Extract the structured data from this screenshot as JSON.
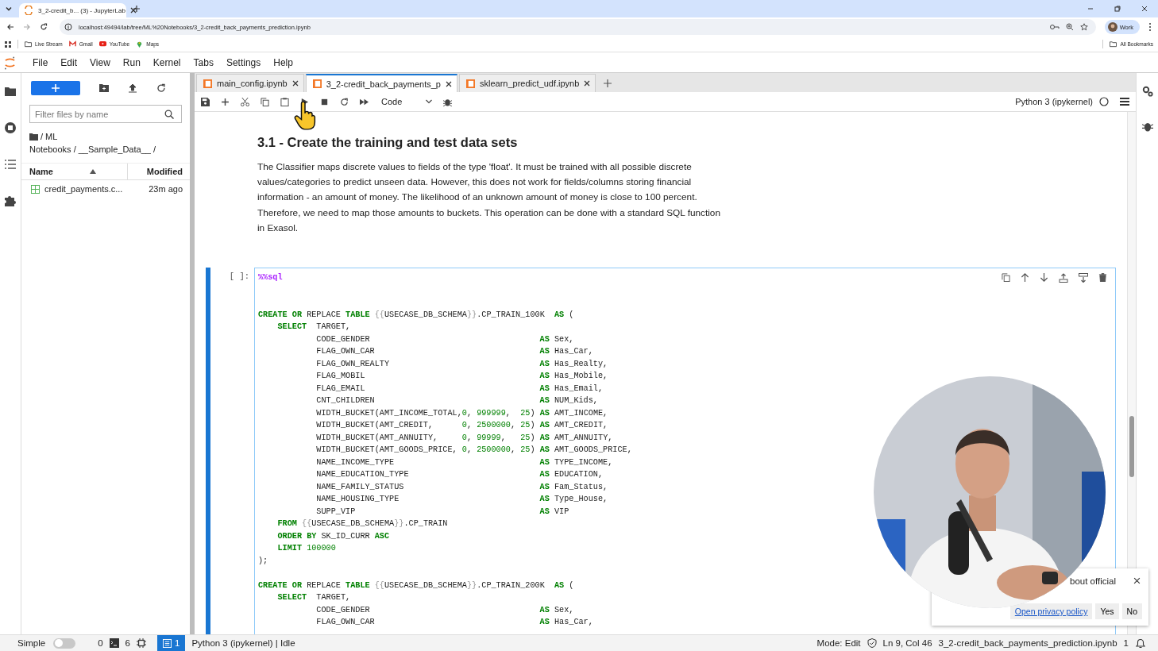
{
  "browser": {
    "tab_title": "3_2-credit_b... (3) - JupyterLab",
    "url": "localhost:49494/lab/tree/ML%20Notebooks/3_2-credit_back_payments_prediction.ipynb",
    "profile": "Work",
    "all_bookmarks": "All Bookmarks",
    "bookmarks": [
      {
        "label": "Live Stream",
        "kind": "folder"
      },
      {
        "label": "Gmail",
        "kind": "gmail"
      },
      {
        "label": "YouTube",
        "kind": "youtube"
      },
      {
        "label": "Maps",
        "kind": "maps"
      }
    ]
  },
  "menu": [
    "File",
    "Edit",
    "View",
    "Run",
    "Kernel",
    "Tabs",
    "Settings",
    "Help"
  ],
  "file_browser": {
    "filter_placeholder": "Filter files by name",
    "breadcrumb": [
      "/ ML",
      "Notebooks / __Sample_Data__ /"
    ],
    "columns": [
      {
        "label": "Name",
        "sorted": true
      },
      {
        "label": "Modified",
        "sorted": false
      }
    ],
    "files": [
      {
        "name": "credit_payments.c...",
        "modified": "23m ago",
        "selected": false
      }
    ]
  },
  "notebook_tabs": [
    {
      "label": "main_config.ipynb",
      "selected": false
    },
    {
      "label": "3_2-credit_back_payments_p",
      "selected": true
    },
    {
      "label": "sklearn_predict_udf.ipynb",
      "selected": false
    }
  ],
  "toolbar": {
    "cell_type": "Code",
    "kernel": "Python 3 (ipykernel)"
  },
  "markdown": {
    "heading": "3.1 - Create the training and test data sets",
    "paragraph": "The Classifier maps discrete values to fields of the type 'float'. It must be trained with all possible discrete values/categories to predict unseen data. However, this does not work for fields/columns storing financial information - an amount of money. The likelihood of an unknown amount of money is close to 100 percent. Therefore, we need to map those amounts to buckets. This operation can be done with a standard SQL function in Exasol."
  },
  "code_cell": {
    "prompt": "[ ]:",
    "active": true,
    "magic": "%%sql",
    "lines": [
      {
        "blank_before": false,
        "tokens": [
          {
            "kind": "kw",
            "text": "CREATE"
          },
          {
            "kind": "kw",
            "text": " OR"
          },
          {
            "kind": "plain",
            "text": " REPLACE "
          },
          {
            "kind": "kw",
            "text": "TABLE"
          },
          {
            "kind": "brace",
            "text": " {{"
          },
          {
            "kind": "plain",
            "text": "USECASE_DB_SCHEMA"
          },
          {
            "kind": "brace",
            "text": "}}"
          },
          {
            "kind": "plain",
            "text": ".CP_TRAIN_100K  "
          },
          {
            "kind": "kw",
            "text": "AS"
          },
          {
            "kind": "plain",
            "text": " ("
          }
        ]
      },
      {
        "blank_before": false,
        "tokens": [
          {
            "kind": "kw",
            "text": "    SELECT"
          },
          {
            "kind": "plain",
            "text": "  TARGET,"
          }
        ]
      },
      {
        "blank_before": false,
        "tokens": [
          {
            "kind": "plain",
            "text": "            CODE_GENDER                                   "
          },
          {
            "kind": "kw",
            "text": "AS"
          },
          {
            "kind": "plain",
            "text": " Sex,"
          }
        ]
      },
      {
        "blank_before": false,
        "tokens": [
          {
            "kind": "plain",
            "text": "            FLAG_OWN_CAR                                  "
          },
          {
            "kind": "kw",
            "text": "AS"
          },
          {
            "kind": "plain",
            "text": " Has_Car,"
          }
        ]
      },
      {
        "blank_before": false,
        "tokens": [
          {
            "kind": "plain",
            "text": "            FLAG_OWN_REALTY                               "
          },
          {
            "kind": "kw",
            "text": "AS"
          },
          {
            "kind": "plain",
            "text": " Has_Realty,"
          }
        ]
      },
      {
        "blank_before": false,
        "tokens": [
          {
            "kind": "plain",
            "text": "            FLAG_MOBIL                                    "
          },
          {
            "kind": "kw",
            "text": "AS"
          },
          {
            "kind": "plain",
            "text": " Has_Mobile,"
          }
        ]
      },
      {
        "blank_before": false,
        "tokens": [
          {
            "kind": "plain",
            "text": "            FLAG_EMAIL                                    "
          },
          {
            "kind": "kw",
            "text": "AS"
          },
          {
            "kind": "plain",
            "text": " Has_Email,"
          }
        ]
      },
      {
        "blank_before": false,
        "tokens": [
          {
            "kind": "plain",
            "text": "            CNT_CHILDREN                                  "
          },
          {
            "kind": "kw",
            "text": "AS"
          },
          {
            "kind": "plain",
            "text": " NUM_Kids,"
          }
        ]
      },
      {
        "blank_before": false,
        "tokens": [
          {
            "kind": "plain",
            "text": "            WIDTH_BUCKET(AMT_INCOME_TOTAL,"
          },
          {
            "kind": "num",
            "text": "0"
          },
          {
            "kind": "plain",
            "text": ", "
          },
          {
            "kind": "num",
            "text": "999999"
          },
          {
            "kind": "plain",
            "text": ",  "
          },
          {
            "kind": "num",
            "text": "25"
          },
          {
            "kind": "plain",
            "text": ") "
          },
          {
            "kind": "kw",
            "text": "AS"
          },
          {
            "kind": "plain",
            "text": " AMT_INCOME,"
          }
        ]
      },
      {
        "blank_before": false,
        "tokens": [
          {
            "kind": "plain",
            "text": "            WIDTH_BUCKET(AMT_CREDIT,      "
          },
          {
            "kind": "num",
            "text": "0"
          },
          {
            "kind": "plain",
            "text": ", "
          },
          {
            "kind": "num",
            "text": "2500000"
          },
          {
            "kind": "plain",
            "text": ", "
          },
          {
            "kind": "num",
            "text": "25"
          },
          {
            "kind": "plain",
            "text": ") "
          },
          {
            "kind": "kw",
            "text": "AS"
          },
          {
            "kind": "plain",
            "text": " AMT_CREDIT,"
          }
        ]
      },
      {
        "blank_before": false,
        "tokens": [
          {
            "kind": "plain",
            "text": "            WIDTH_BUCKET(AMT_ANNUITY,     "
          },
          {
            "kind": "num",
            "text": "0"
          },
          {
            "kind": "plain",
            "text": ", "
          },
          {
            "kind": "num",
            "text": "99999"
          },
          {
            "kind": "plain",
            "text": ",   "
          },
          {
            "kind": "num",
            "text": "25"
          },
          {
            "kind": "plain",
            "text": ") "
          },
          {
            "kind": "kw",
            "text": "AS"
          },
          {
            "kind": "plain",
            "text": " AMT_ANNUITY,"
          }
        ]
      },
      {
        "blank_before": false,
        "tokens": [
          {
            "kind": "plain",
            "text": "            WIDTH_BUCKET(AMT_GOODS_PRICE, "
          },
          {
            "kind": "num",
            "text": "0"
          },
          {
            "kind": "plain",
            "text": ", "
          },
          {
            "kind": "num",
            "text": "2500000"
          },
          {
            "kind": "plain",
            "text": ", "
          },
          {
            "kind": "num",
            "text": "25"
          },
          {
            "kind": "plain",
            "text": ") "
          },
          {
            "kind": "kw",
            "text": "AS"
          },
          {
            "kind": "plain",
            "text": " AMT_GOODS_PRICE,"
          }
        ]
      },
      {
        "blank_before": false,
        "tokens": [
          {
            "kind": "plain",
            "text": "            NAME_INCOME_TYPE                              "
          },
          {
            "kind": "kw",
            "text": "AS"
          },
          {
            "kind": "plain",
            "text": " TYPE_INCOME,"
          }
        ]
      },
      {
        "blank_before": false,
        "tokens": [
          {
            "kind": "plain",
            "text": "            NAME_EDUCATION_TYPE                           "
          },
          {
            "kind": "kw",
            "text": "AS"
          },
          {
            "kind": "plain",
            "text": " EDUCATION,"
          }
        ]
      },
      {
        "blank_before": false,
        "tokens": [
          {
            "kind": "plain",
            "text": "            NAME_FAMILY_STATUS                            "
          },
          {
            "kind": "kw",
            "text": "AS"
          },
          {
            "kind": "plain",
            "text": " Fam_Status,"
          }
        ]
      },
      {
        "blank_before": false,
        "tokens": [
          {
            "kind": "plain",
            "text": "            NAME_HOUSING_TYPE                             "
          },
          {
            "kind": "kw",
            "text": "AS"
          },
          {
            "kind": "plain",
            "text": " Type_House,"
          }
        ]
      },
      {
        "blank_before": false,
        "tokens": [
          {
            "kind": "plain",
            "text": "            SUPP_VIP                                      "
          },
          {
            "kind": "kw",
            "text": "AS"
          },
          {
            "kind": "plain",
            "text": " VIP"
          }
        ]
      },
      {
        "blank_before": false,
        "tokens": [
          {
            "kind": "kw",
            "text": "    FROM"
          },
          {
            "kind": "brace",
            "text": " {{"
          },
          {
            "kind": "plain",
            "text": "USECASE_DB_SCHEMA"
          },
          {
            "kind": "brace",
            "text": "}}"
          },
          {
            "kind": "plain",
            "text": ".CP_TRAIN"
          }
        ]
      },
      {
        "blank_before": false,
        "tokens": [
          {
            "kind": "kw",
            "text": "    ORDER"
          },
          {
            "kind": "kw",
            "text": " BY"
          },
          {
            "kind": "plain",
            "text": " SK_ID_CURR "
          },
          {
            "kind": "kw",
            "text": "ASC"
          }
        ]
      },
      {
        "blank_before": false,
        "tokens": [
          {
            "kind": "kw",
            "text": "    LIMIT"
          },
          {
            "kind": "num",
            "text": " 100000"
          }
        ]
      },
      {
        "blank_before": false,
        "tokens": [
          {
            "kind": "plain",
            "text": ");"
          }
        ]
      },
      {
        "blank_before": true,
        "tokens": [
          {
            "kind": "kw",
            "text": "CREATE"
          },
          {
            "kind": "kw",
            "text": " OR"
          },
          {
            "kind": "plain",
            "text": " REPLACE "
          },
          {
            "kind": "kw",
            "text": "TABLE"
          },
          {
            "kind": "brace",
            "text": " {{"
          },
          {
            "kind": "plain",
            "text": "USECASE_DB_SCHEMA"
          },
          {
            "kind": "brace",
            "text": "}}"
          },
          {
            "kind": "plain",
            "text": ".CP_TRAIN_200K  "
          },
          {
            "kind": "kw",
            "text": "AS"
          },
          {
            "kind": "plain",
            "text": " ("
          }
        ]
      },
      {
        "blank_before": false,
        "tokens": [
          {
            "kind": "kw",
            "text": "    SELECT"
          },
          {
            "kind": "plain",
            "text": "  TARGET,"
          }
        ]
      },
      {
        "blank_before": false,
        "tokens": [
          {
            "kind": "plain",
            "text": "            CODE_GENDER                                   "
          },
          {
            "kind": "kw",
            "text": "AS"
          },
          {
            "kind": "plain",
            "text": " Sex,"
          }
        ]
      },
      {
        "blank_before": false,
        "tokens": [
          {
            "kind": "plain",
            "text": "            FLAG_OWN_CAR                                  "
          },
          {
            "kind": "kw",
            "text": "AS"
          },
          {
            "kind": "plain",
            "text": " Has_Car,"
          }
        ]
      }
    ]
  },
  "video_overlay": {
    "kind": "picture"
  },
  "notification": {
    "text": "bout official",
    "link": "Open privacy policy",
    "buttons": [
      "Yes",
      "No"
    ]
  },
  "status_bar": {
    "simple_label": "Simple",
    "simple_on": false,
    "terminals": "0",
    "kernels": "6",
    "badge": "1",
    "kernel_status": "Python 3 (ipykernel) | Idle",
    "mode": "Mode: Edit",
    "position": "Ln 9, Col 46",
    "file": "3_2-credit_back_payments_prediction.ipynb",
    "notifications": "1"
  }
}
